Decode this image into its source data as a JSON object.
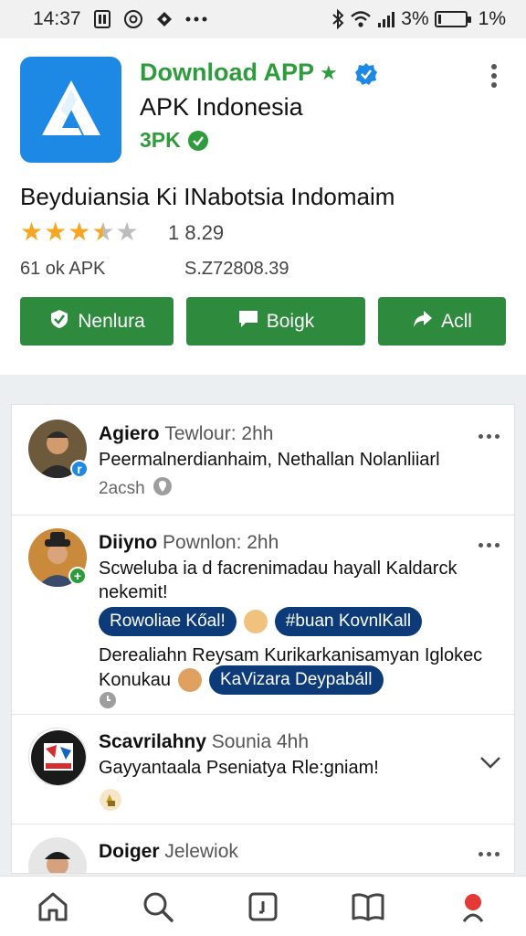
{
  "status_bar": {
    "time": "14:37",
    "signal_pct": "3%",
    "battery_pct": "1%",
    "battery_level": 0.1,
    "left_icons": [
      "sim-icon",
      "at-icon",
      "location-icon",
      "more-dots-icon"
    ],
    "right_icons": [
      "bluetooth-icon",
      "wifi-icon",
      "signal-icon",
      "battery-icon"
    ]
  },
  "app": {
    "name": "Download APP",
    "publisher": "APK Indonesia",
    "tag": "3PK",
    "title": "Beyduiansia Ki INabotsia Indomaim",
    "rating": 3.5,
    "rating_value": "1 8.29",
    "size": "61 ok APK",
    "downloads": "S.Z72808.39",
    "brand_color": "#2e9c3c",
    "icon_color": "#1e88e5",
    "buttons": [
      {
        "label": "Nenlura",
        "icon": "shield-icon"
      },
      {
        "label": "Boigk",
        "icon": "chat-icon"
      },
      {
        "label": "Acll",
        "icon": "share-icon"
      }
    ]
  },
  "feed": {
    "posts": [
      {
        "name": "Agiero",
        "handle": "Tewlour: 2hh",
        "text": "Peermalnerdianhaim, Nethallan Nolanliiarl",
        "meta": "2acsh"
      },
      {
        "name": "Diiyno",
        "handle": "Pownlon: 2hh",
        "text": "Scweluba ia d facrenimadau hayall Kaldarck nekemit!",
        "chips1": [
          "Rowoliae Kőal!",
          "#buan KovnlKall"
        ],
        "text2": "Derealiahn Reysam Kurikarkanisamyan Iglokec",
        "text3": "Konukau",
        "chip2": "KaVizara Deypabáll"
      },
      {
        "name": "Scavrilahny",
        "handle": "Sounia 4hh",
        "text": "Gayyantaala Pseniatya Rle:gniam!"
      },
      {
        "name": "Doiger",
        "handle": "Jelewiok"
      }
    ]
  },
  "bottom_nav": [
    "home-icon",
    "search-icon",
    "add-icon",
    "book-icon",
    "profile-icon"
  ]
}
